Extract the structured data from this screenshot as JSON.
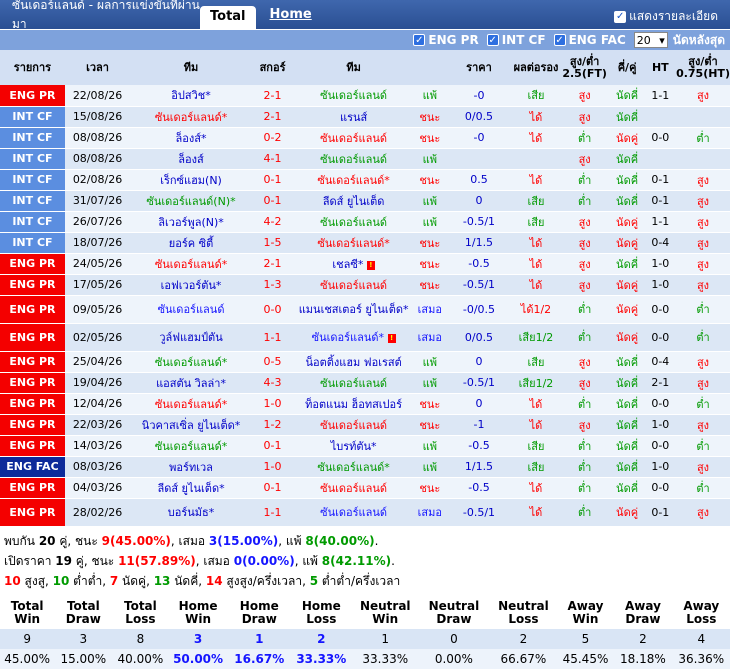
{
  "header": {
    "title": "ซันเดอร์แลนด์ - ผลการแข่งขันที่ผ่านมา",
    "tab_total": "Total",
    "tab_home": "Home",
    "show_detail": "แสดงรายละเอียด"
  },
  "filters": {
    "eng_pr": "ENG PR",
    "int_cf": "INT CF",
    "eng_fac": "ENG FAC",
    "count": "20",
    "last": "นัดหลังสุด"
  },
  "columns": [
    "รายการ",
    "เวลา",
    "ทีม",
    "สกอร์",
    "ทีม",
    "",
    "ราคา",
    "ผลต่อรอง",
    "สูง/ต่ำ 2.5(FT)",
    "คี่/คู่",
    "HT",
    "สูง/ต่ำ 0.75(HT)"
  ],
  "rows": [
    {
      "league": "ENG PR",
      "lc": "ENGPR",
      "date": "22/08/26",
      "home": "อิปสวิช*",
      "hc": "navy",
      "score": "2-1",
      "away": "ซันเดอร์แลนด์",
      "ac": "green",
      "res": "แพ้",
      "odds": "-0",
      "hdp": "เสีย",
      "ou": "สูง",
      "oe": "นัดคี่",
      "ht": "1-1",
      "ht_ou": "สูง",
      "tall": false
    },
    {
      "league": "INT CF",
      "lc": "INTCF",
      "date": "15/08/26",
      "home": "ซันเดอร์แลนด์*",
      "hc": "red",
      "score": "2-1",
      "away": "แรนส์",
      "ac": "navy",
      "res": "ชนะ",
      "odds": "0/0.5",
      "hdp": "ได้",
      "ou": "สูง",
      "oe": "นัดคี่",
      "ht": "",
      "ht_ou": "",
      "tall": false
    },
    {
      "league": "INT CF",
      "lc": "INTCF",
      "date": "08/08/26",
      "home": "ล็องส์*",
      "hc": "navy",
      "score": "0-2",
      "away": "ซันเดอร์แลนด์",
      "ac": "red",
      "res": "ชนะ",
      "odds": "-0",
      "hdp": "ได้",
      "ou": "ต่ำ",
      "oe": "นัดคู่",
      "ht": "0-0",
      "ht_ou": "ต่ำ",
      "tall": false
    },
    {
      "league": "INT CF",
      "lc": "INTCF",
      "date": "08/08/26",
      "home": "ล็องส์",
      "hc": "navy",
      "score": "4-1",
      "away": "ซันเดอร์แลนด์",
      "ac": "green",
      "res": "แพ้",
      "odds": "",
      "hdp": "",
      "ou": "สูง",
      "oe": "นัดคี่",
      "ht": "",
      "ht_ou": "",
      "tall": false
    },
    {
      "league": "INT CF",
      "lc": "INTCF",
      "date": "02/08/26",
      "home": "เร็กซ์แฮม(N)",
      "hc": "navy",
      "score": "0-1",
      "away": "ซันเดอร์แลนด์*",
      "ac": "red",
      "res": "ชนะ",
      "odds": "0.5",
      "hdp": "ได้",
      "ou": "ต่ำ",
      "oe": "นัดคี่",
      "ht": "0-1",
      "ht_ou": "สูง",
      "tall": false
    },
    {
      "league": "INT CF",
      "lc": "INTCF",
      "date": "31/07/26",
      "home": "ซันเดอร์แลนด์(N)*",
      "hc": "green",
      "score": "0-1",
      "away": "ลีดส์ ยูไนเต็ด",
      "ac": "navy",
      "res": "แพ้",
      "odds": "0",
      "hdp": "เสีย",
      "ou": "ต่ำ",
      "oe": "นัดคี่",
      "ht": "0-1",
      "ht_ou": "สูง",
      "tall": false
    },
    {
      "league": "INT CF",
      "lc": "INTCF",
      "date": "26/07/26",
      "home": "ลิเวอร์พูล(N)*",
      "hc": "navy",
      "score": "4-2",
      "away": "ซันเดอร์แลนด์",
      "ac": "green",
      "res": "แพ้",
      "odds": "-0.5/1",
      "hdp": "เสีย",
      "ou": "สูง",
      "oe": "นัดคู่",
      "ht": "1-1",
      "ht_ou": "สูง",
      "tall": false
    },
    {
      "league": "INT CF",
      "lc": "INTCF",
      "date": "18/07/26",
      "home": "ยอร์ค ซิตี้",
      "hc": "navy",
      "score": "1-5",
      "away": "ซันเดอร์แลนด์*",
      "ac": "red",
      "res": "ชนะ",
      "odds": "1/1.5",
      "hdp": "ได้",
      "ou": "สูง",
      "oe": "นัดคู่",
      "ht": "0-4",
      "ht_ou": "สูง",
      "tall": false
    },
    {
      "league": "ENG PR",
      "lc": "ENGPR",
      "date": "24/05/26",
      "home": "ซันเดอร์แลนด์*",
      "hc": "red",
      "score": "2-1",
      "away": "เชลซี*",
      "ac": "navy",
      "res": "ชนะ",
      "odds": "-0.5",
      "hdp": "ได้",
      "ou": "สูง",
      "oe": "นัดคี่",
      "ht": "1-0",
      "ht_ou": "สูง",
      "tall": false,
      "flag": "away"
    },
    {
      "league": "ENG PR",
      "lc": "ENGPR",
      "date": "17/05/26",
      "home": "เอฟเวอร์ตัน*",
      "hc": "navy",
      "score": "1-3",
      "away": "ซันเดอร์แลนด์",
      "ac": "red",
      "res": "ชนะ",
      "odds": "-0.5/1",
      "hdp": "ได้",
      "ou": "สูง",
      "oe": "นัดคู่",
      "ht": "1-0",
      "ht_ou": "สูง",
      "tall": false
    },
    {
      "league": "ENG PR",
      "lc": "ENGPR",
      "date": "09/05/26",
      "home": "ซันเดอร์แลนด์",
      "hc": "blue",
      "score": "0-0",
      "away": "แมนเชสเตอร์ ยูไนเต็ด*",
      "ac": "navy",
      "res": "เสมอ",
      "odds": "-0/0.5",
      "hdp": "ได้1/2",
      "ou": "ต่ำ",
      "oe": "นัดคู่",
      "ht": "0-0",
      "ht_ou": "ต่ำ",
      "tall": true
    },
    {
      "league": "ENG PR",
      "lc": "ENGPR",
      "date": "02/05/26",
      "home": "วูล์ฟแฮมป์ตัน",
      "hc": "navy",
      "score": "1-1",
      "away": "ซันเดอร์แลนด์*",
      "ac": "blue",
      "res": "เสมอ",
      "odds": "0/0.5",
      "hdp": "เสีย1/2",
      "ou": "ต่ำ",
      "oe": "นัดคู่",
      "ht": "0-0",
      "ht_ou": "ต่ำ",
      "tall": true,
      "flag": "away"
    },
    {
      "league": "ENG PR",
      "lc": "ENGPR",
      "date": "25/04/26",
      "home": "ซันเดอร์แลนด์*",
      "hc": "green",
      "score": "0-5",
      "away": "น็อตติ้งแฮม ฟอเรสต์",
      "ac": "navy",
      "res": "แพ้",
      "odds": "0",
      "hdp": "เสีย",
      "ou": "สูง",
      "oe": "นัดคี่",
      "ht": "0-4",
      "ht_ou": "สูง",
      "tall": false
    },
    {
      "league": "ENG PR",
      "lc": "ENGPR",
      "date": "19/04/26",
      "home": "แอสตัน วิลล่า*",
      "hc": "navy",
      "score": "4-3",
      "away": "ซันเดอร์แลนด์",
      "ac": "green",
      "res": "แพ้",
      "odds": "-0.5/1",
      "hdp": "เสีย1/2",
      "ou": "สูง",
      "oe": "นัดคี่",
      "ht": "2-1",
      "ht_ou": "สูง",
      "tall": false
    },
    {
      "league": "ENG PR",
      "lc": "ENGPR",
      "date": "12/04/26",
      "home": "ซันเดอร์แลนด์*",
      "hc": "red",
      "score": "1-0",
      "away": "ท็อตแนม ฮ็อทสเปอร์",
      "ac": "navy",
      "res": "ชนะ",
      "odds": "0",
      "hdp": "ได้",
      "ou": "ต่ำ",
      "oe": "นัดคี่",
      "ht": "0-0",
      "ht_ou": "ต่ำ",
      "tall": false
    },
    {
      "league": "ENG PR",
      "lc": "ENGPR",
      "date": "22/03/26",
      "home": "นิวคาสเซิ่ล ยูไนเต็ด*",
      "hc": "navy",
      "score": "1-2",
      "away": "ซันเดอร์แลนด์",
      "ac": "red",
      "res": "ชนะ",
      "odds": "-1",
      "hdp": "ได้",
      "ou": "สูง",
      "oe": "นัดคี่",
      "ht": "1-0",
      "ht_ou": "สูง",
      "tall": false
    },
    {
      "league": "ENG PR",
      "lc": "ENGPR",
      "date": "14/03/26",
      "home": "ซันเดอร์แลนด์*",
      "hc": "green",
      "score": "0-1",
      "away": "ไบรท์ตัน*",
      "ac": "navy",
      "res": "แพ้",
      "odds": "-0.5",
      "hdp": "เสีย",
      "ou": "ต่ำ",
      "oe": "นัดคี่",
      "ht": "0-0",
      "ht_ou": "ต่ำ",
      "tall": false
    },
    {
      "league": "ENG FAC",
      "lc": "ENGFAC",
      "date": "08/03/26",
      "home": "พอร์ทเวล",
      "hc": "navy",
      "score": "1-0",
      "away": "ซันเดอร์แลนด์*",
      "ac": "green",
      "res": "แพ้",
      "odds": "1/1.5",
      "hdp": "เสีย",
      "ou": "ต่ำ",
      "oe": "นัดคี่",
      "ht": "1-0",
      "ht_ou": "สูง",
      "tall": false
    },
    {
      "league": "ENG PR",
      "lc": "ENGPR",
      "date": "04/03/26",
      "home": "ลีดส์ ยูไนเต็ด*",
      "hc": "navy",
      "score": "0-1",
      "away": "ซันเดอร์แลนด์",
      "ac": "red",
      "res": "ชนะ",
      "odds": "-0.5",
      "hdp": "ได้",
      "ou": "ต่ำ",
      "oe": "นัดคี่",
      "ht": "0-0",
      "ht_ou": "ต่ำ",
      "tall": false
    },
    {
      "league": "ENG PR",
      "lc": "ENGPR",
      "date": "28/02/26",
      "home": "บอร์นมัธ*",
      "hc": "navy",
      "score": "1-1",
      "away": "ซันเดอร์แลนด์",
      "ac": "blue",
      "res": "เสมอ",
      "odds": "-0.5/1",
      "hdp": "ได้",
      "ou": "ต่ำ",
      "oe": "นัดคู่",
      "ht": "0-1",
      "ht_ou": "สูง",
      "tall": true
    }
  ],
  "summary": {
    "line1": {
      "a": "พบกัน ",
      "n": "20",
      "b": " คู่, ชนะ ",
      "w": "9",
      "wp": "(45.00%)",
      "c": ", เสมอ ",
      "d": "3",
      "dp": "(15.00%)",
      "e": ", แพ้ ",
      "l": "8",
      "lp": "(40.00%)",
      "f": "."
    },
    "line2": {
      "a": "เปิดราคา ",
      "n": "19",
      "b": " คู่, ชนะ ",
      "w": "11",
      "wp": "(57.89%)",
      "c": ", เสมอ ",
      "d": "0",
      "dp": "(0.00%)",
      "e": ", แพ้ ",
      "l": "8",
      "lp": "(42.11%)",
      "f": "."
    },
    "line3": {
      "a": "10",
      "b": " สูงสู, ",
      "c": "10",
      "d": " ต่ำต่ำ, ",
      "e": "7",
      "f": " นัดคู่, ",
      "g": "13",
      "h": " นัดคี่, ",
      "i": "14",
      "j": " สูงสูง/ครึ่งเวลา, ",
      "k": "5",
      "l": " ต่ำต่ำ/ครึ่งเวลา"
    }
  },
  "stats": {
    "headers": [
      "Total Win",
      "Total Draw",
      "Total Loss",
      "Home Win",
      "Home Draw",
      "Home Loss",
      "Neutral Win",
      "Neutral Draw",
      "Neutral Loss",
      "Away Win",
      "Away Draw",
      "Away Loss"
    ],
    "counts": [
      "9",
      "3",
      "8",
      "3",
      "1",
      "2",
      "1",
      "0",
      "2",
      "5",
      "2",
      "4"
    ],
    "pcts": [
      "45.00%",
      "15.00%",
      "40.00%",
      "50.00%",
      "16.67%",
      "33.33%",
      "33.33%",
      "0.00%",
      "66.67%",
      "45.45%",
      "18.18%",
      "36.36%"
    ]
  }
}
